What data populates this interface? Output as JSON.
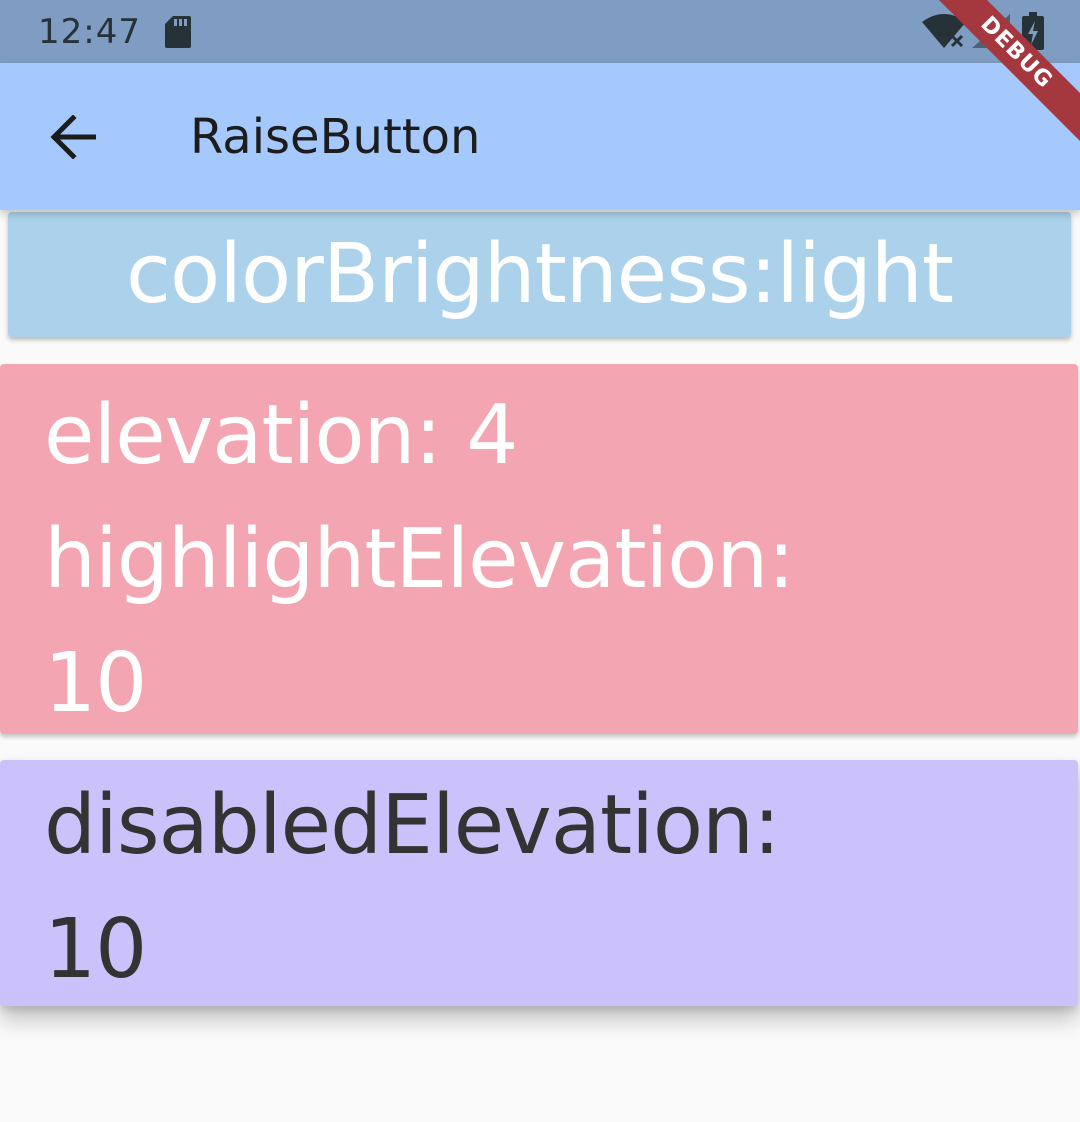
{
  "status_bar": {
    "time": "12:47",
    "icons": [
      "sd-card-icon",
      "wifi-off-icon",
      "signal-icon",
      "battery-charging-icon"
    ]
  },
  "app_bar": {
    "back_icon": "arrow-left-icon",
    "title": "RaiseButton"
  },
  "debug_banner": {
    "label": "DEBUG"
  },
  "buttons": {
    "brightness": {
      "label": "colorBrightness:light",
      "color": "#acd2eb",
      "text_color": "#ffffff"
    },
    "elevation": {
      "line1": "elevation: 4",
      "line2": "highlightElevation:",
      "line3": "10",
      "color": "#f3a6b1",
      "text_color": "#ffffff"
    },
    "disabled": {
      "line1": "disabledElevation:",
      "line2": "10",
      "color": "#ccc2fb",
      "text_color": "#333333"
    }
  },
  "colors": {
    "status_bar": "#7f9cc2",
    "app_bar": "#a6c9fd",
    "background": "#fafafa",
    "debug_ribbon": "#a5373f"
  }
}
